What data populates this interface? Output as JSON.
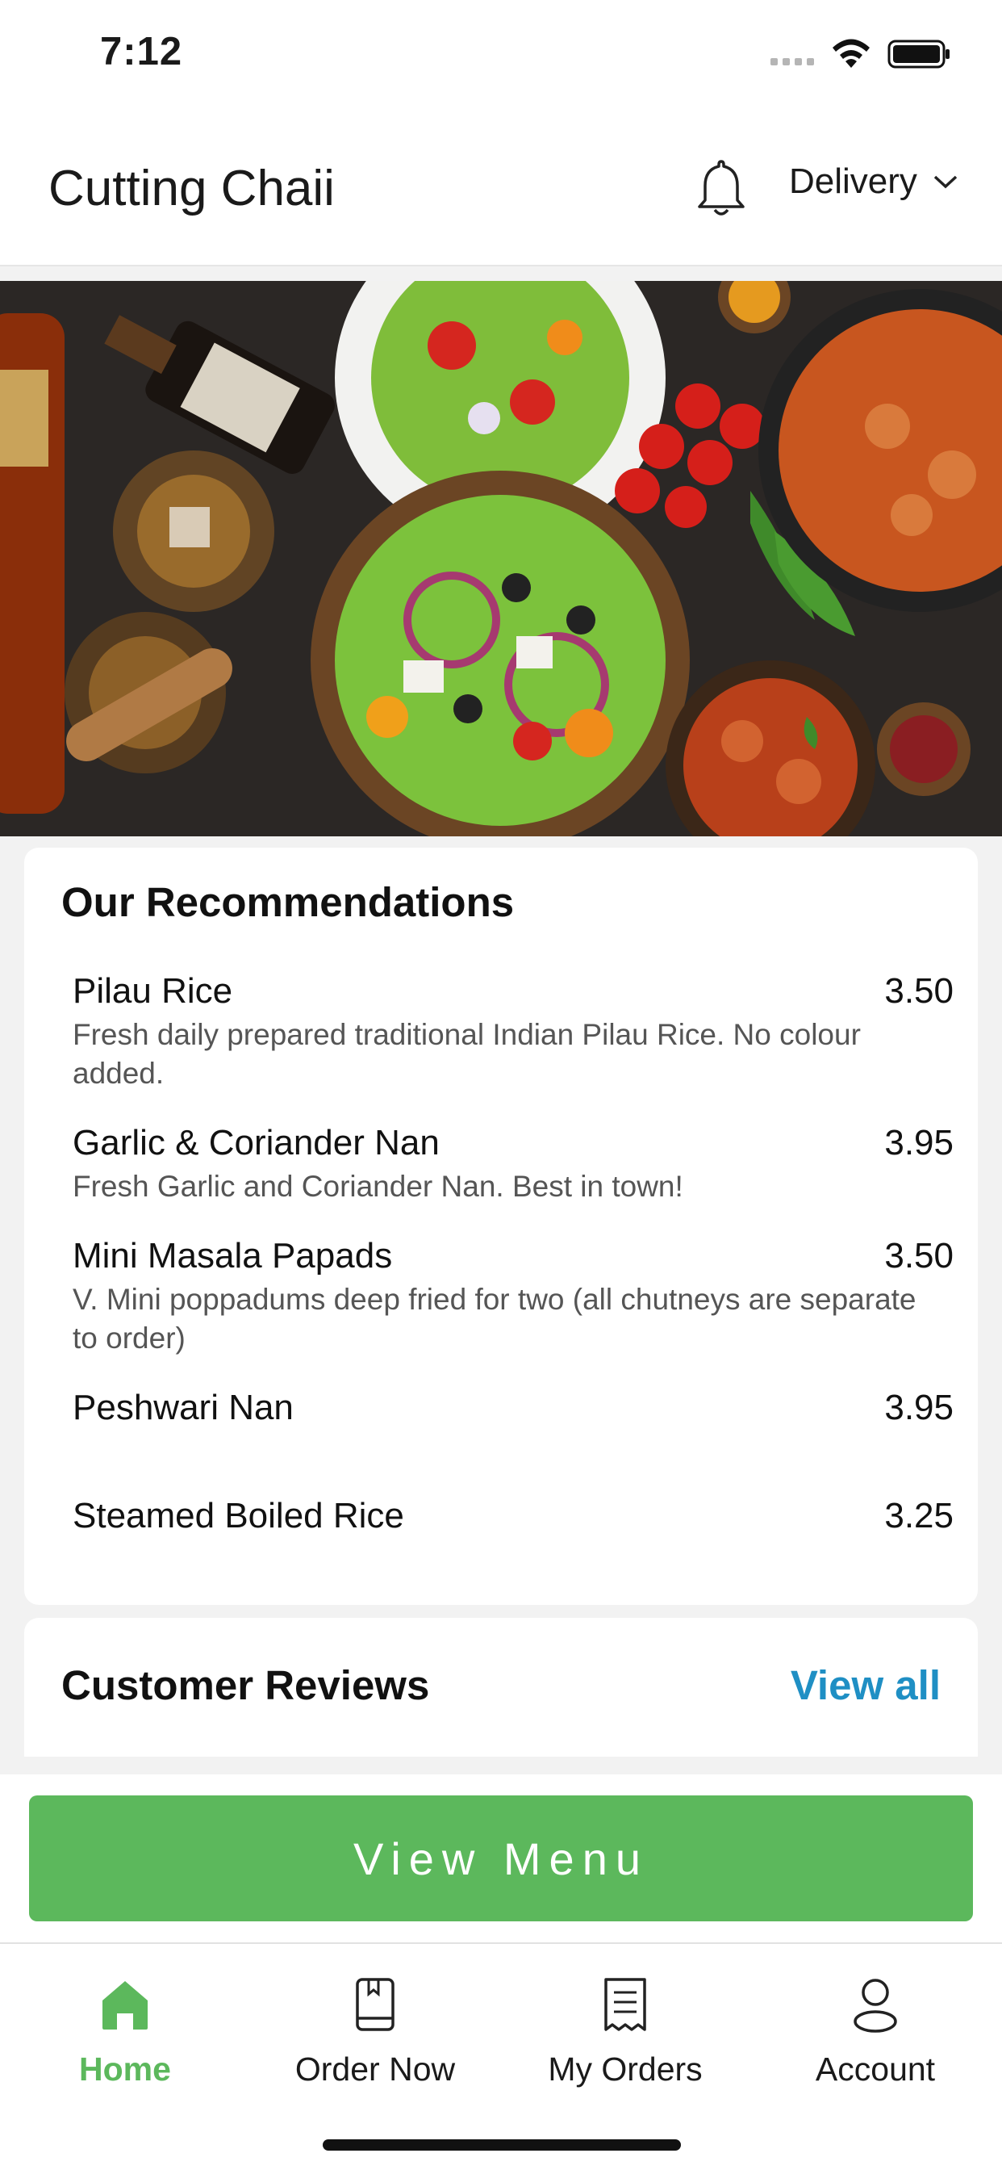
{
  "status_bar": {
    "time": "7:12"
  },
  "header": {
    "title": "Cutting Chaii",
    "order_mode": "Delivery"
  },
  "recommendations": {
    "title": "Our Recommendations",
    "items": [
      {
        "name": "Pilau Rice",
        "price": "3.50",
        "description": "Fresh daily prepared traditional Indian Pilau Rice. No colour added."
      },
      {
        "name": "Garlic & Coriander Nan",
        "price": "3.95",
        "description": "Fresh Garlic and Coriander Nan. Best in town!"
      },
      {
        "name": "Mini Masala Papads",
        "price": "3.50",
        "description": "V. Mini poppadums deep fried for two (all chutneys are separate to order)"
      },
      {
        "name": "Peshwari Nan",
        "price": "3.95",
        "description": ""
      },
      {
        "name": "Steamed Boiled Rice",
        "price": "3.25",
        "description": ""
      }
    ]
  },
  "reviews": {
    "title": "Customer Reviews",
    "view_all": "View all"
  },
  "cta": {
    "label": "View Menu"
  },
  "bottom_nav": {
    "items": [
      {
        "label": "Home",
        "icon": "home-icon",
        "active": true
      },
      {
        "label": "Order Now",
        "icon": "order-book-icon",
        "active": false
      },
      {
        "label": "My Orders",
        "icon": "receipt-icon",
        "active": false
      },
      {
        "label": "Account",
        "icon": "user-icon",
        "active": false
      }
    ]
  },
  "colors": {
    "accent": "#5cb85c",
    "link": "#1f8fc4"
  }
}
